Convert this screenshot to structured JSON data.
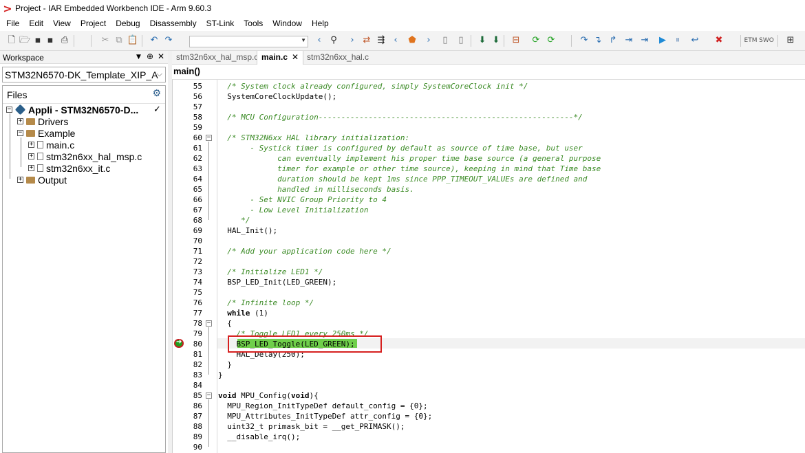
{
  "window": {
    "title": "Project - IAR Embedded Workbench IDE - Arm 9.60.3",
    "logo": ">"
  },
  "menu": [
    "File",
    "Edit",
    "View",
    "Project",
    "Debug",
    "Disassembly",
    "ST-Link",
    "Tools",
    "Window",
    "Help"
  ],
  "toolbar": {
    "search_value": "",
    "etm_label": "ETM",
    "swo_label": "SWO",
    "icons": [
      "new-file-icon",
      "open-icon",
      "save-icon",
      "save-all-icon",
      "print-icon",
      "cut-icon",
      "copy-icon",
      "paste-icon",
      "undo-icon",
      "redo-icon",
      "back-icon",
      "find-icon",
      "forward-icon",
      "toggle-bookmark-icon",
      "goto-icon",
      "prev-bookmark-icon",
      "bookmark-icon",
      "next-bookmark-icon",
      "find-prev-icon",
      "find-next-icon",
      "download-icon",
      "download-debug-icon",
      "build-icon",
      "make-icon",
      "reset-icon",
      "step-over-icon",
      "step-into-icon",
      "step-out-icon",
      "next-statement-icon",
      "run-to-cursor-icon",
      "go-icon",
      "break-icon",
      "reset-debug-icon",
      "stop-debug-icon"
    ]
  },
  "workspace": {
    "header": "Workspace",
    "pin": "▼",
    "pin2": "⊕",
    "close": "✕",
    "config": "STM32N6570-DK_Template_XIP_A",
    "files_label": "Files",
    "tree": {
      "root": "Appli - STM32N6570-D...",
      "root_check": "✓",
      "items": [
        {
          "label": "Drivers",
          "type": "folder"
        },
        {
          "label": "Example",
          "type": "folder"
        },
        {
          "label": "main.c",
          "type": "file"
        },
        {
          "label": "stm32n6xx_hal_msp.c",
          "type": "file"
        },
        {
          "label": "stm32n6xx_it.c",
          "type": "file"
        },
        {
          "label": "Output",
          "type": "folder"
        }
      ]
    }
  },
  "editor": {
    "tabs": [
      {
        "label": "stm32n6xx_hal_msp.c",
        "active": false
      },
      {
        "label": "main.c",
        "active": true,
        "close": "✕"
      },
      {
        "label": "stm32n6xx_hal.c",
        "active": false
      }
    ],
    "function_label": "main()",
    "lines": [
      {
        "n": "55",
        "t": "  /* System clock already configured, simply SystemCoreClock init */",
        "c": "cm"
      },
      {
        "n": "56",
        "t": "  SystemCoreClockUpdate();",
        "c": ""
      },
      {
        "n": "57",
        "t": "",
        "c": ""
      },
      {
        "n": "58",
        "t": "  /* MCU Configuration--------------------------------------------------------*/",
        "c": "cm"
      },
      {
        "n": "59",
        "t": "",
        "c": ""
      },
      {
        "n": "60",
        "t": "  /* STM32N6xx HAL library initialization:",
        "c": "cm"
      },
      {
        "n": "61",
        "t": "       - Systick timer is configured by default as source of time base, but user",
        "c": "cm"
      },
      {
        "n": "62",
        "t": "             can eventually implement his proper time base source (a general purpose",
        "c": "cm"
      },
      {
        "n": "63",
        "t": "             timer for example or other time source), keeping in mind that Time base",
        "c": "cm"
      },
      {
        "n": "64",
        "t": "             duration should be kept 1ms since PPP_TIMEOUT_VALUEs are defined and",
        "c": "cm"
      },
      {
        "n": "65",
        "t": "             handled in milliseconds basis.",
        "c": "cm"
      },
      {
        "n": "66",
        "t": "       - Set NVIC Group Priority to 4",
        "c": "cm"
      },
      {
        "n": "67",
        "t": "       - Low Level Initialization",
        "c": "cm"
      },
      {
        "n": "68",
        "t": "     */",
        "c": "cm"
      },
      {
        "n": "69",
        "t": "  HAL_Init();",
        "c": ""
      },
      {
        "n": "70",
        "t": "",
        "c": ""
      },
      {
        "n": "71",
        "t": "  /* Add your application code here */",
        "c": "cm"
      },
      {
        "n": "72",
        "t": "",
        "c": ""
      },
      {
        "n": "73",
        "t": "  /* Initialize LED1 */",
        "c": "cm"
      },
      {
        "n": "74",
        "t": "  BSP_LED_Init(LED_GREEN);",
        "c": ""
      },
      {
        "n": "75",
        "t": "",
        "c": ""
      },
      {
        "n": "76",
        "t": "  /* Infinite loop */",
        "c": "cm"
      },
      {
        "n": "77",
        "t": "  while (1)",
        "c": "kwline"
      },
      {
        "n": "78",
        "t": "  {",
        "c": ""
      },
      {
        "n": "79",
        "t": "    /* Toggle LED1 every 250ms */",
        "c": "cm"
      },
      {
        "n": "80",
        "t": "    BSP_LED_Toggle(LED_GREEN);",
        "c": ""
      },
      {
        "n": "81",
        "t": "    HAL_Delay(250);",
        "c": ""
      },
      {
        "n": "82",
        "t": "  }",
        "c": ""
      },
      {
        "n": "83",
        "t": "}",
        "c": ""
      },
      {
        "n": "84",
        "t": "",
        "c": ""
      },
      {
        "n": "85",
        "t": "void MPU_Config(void){",
        "c": "kwline2"
      },
      {
        "n": "86",
        "t": "  MPU_Region_InitTypeDef default_config = {0};",
        "c": ""
      },
      {
        "n": "87",
        "t": "  MPU_Attributes_InitTypeDef attr_config = {0};",
        "c": ""
      },
      {
        "n": "88",
        "t": "  uint32_t primask_bit = __get_PRIMASK();",
        "c": ""
      },
      {
        "n": "89",
        "t": "  __disable_irq();",
        "c": ""
      },
      {
        "n": "90",
        "t": "",
        "c": ""
      }
    ],
    "current_line": "80",
    "exec_arrow": "➔"
  },
  "colors": {
    "comment": "#3a8a24",
    "highlight": "#6fcf4a",
    "annotation_box": "#d6201f"
  }
}
